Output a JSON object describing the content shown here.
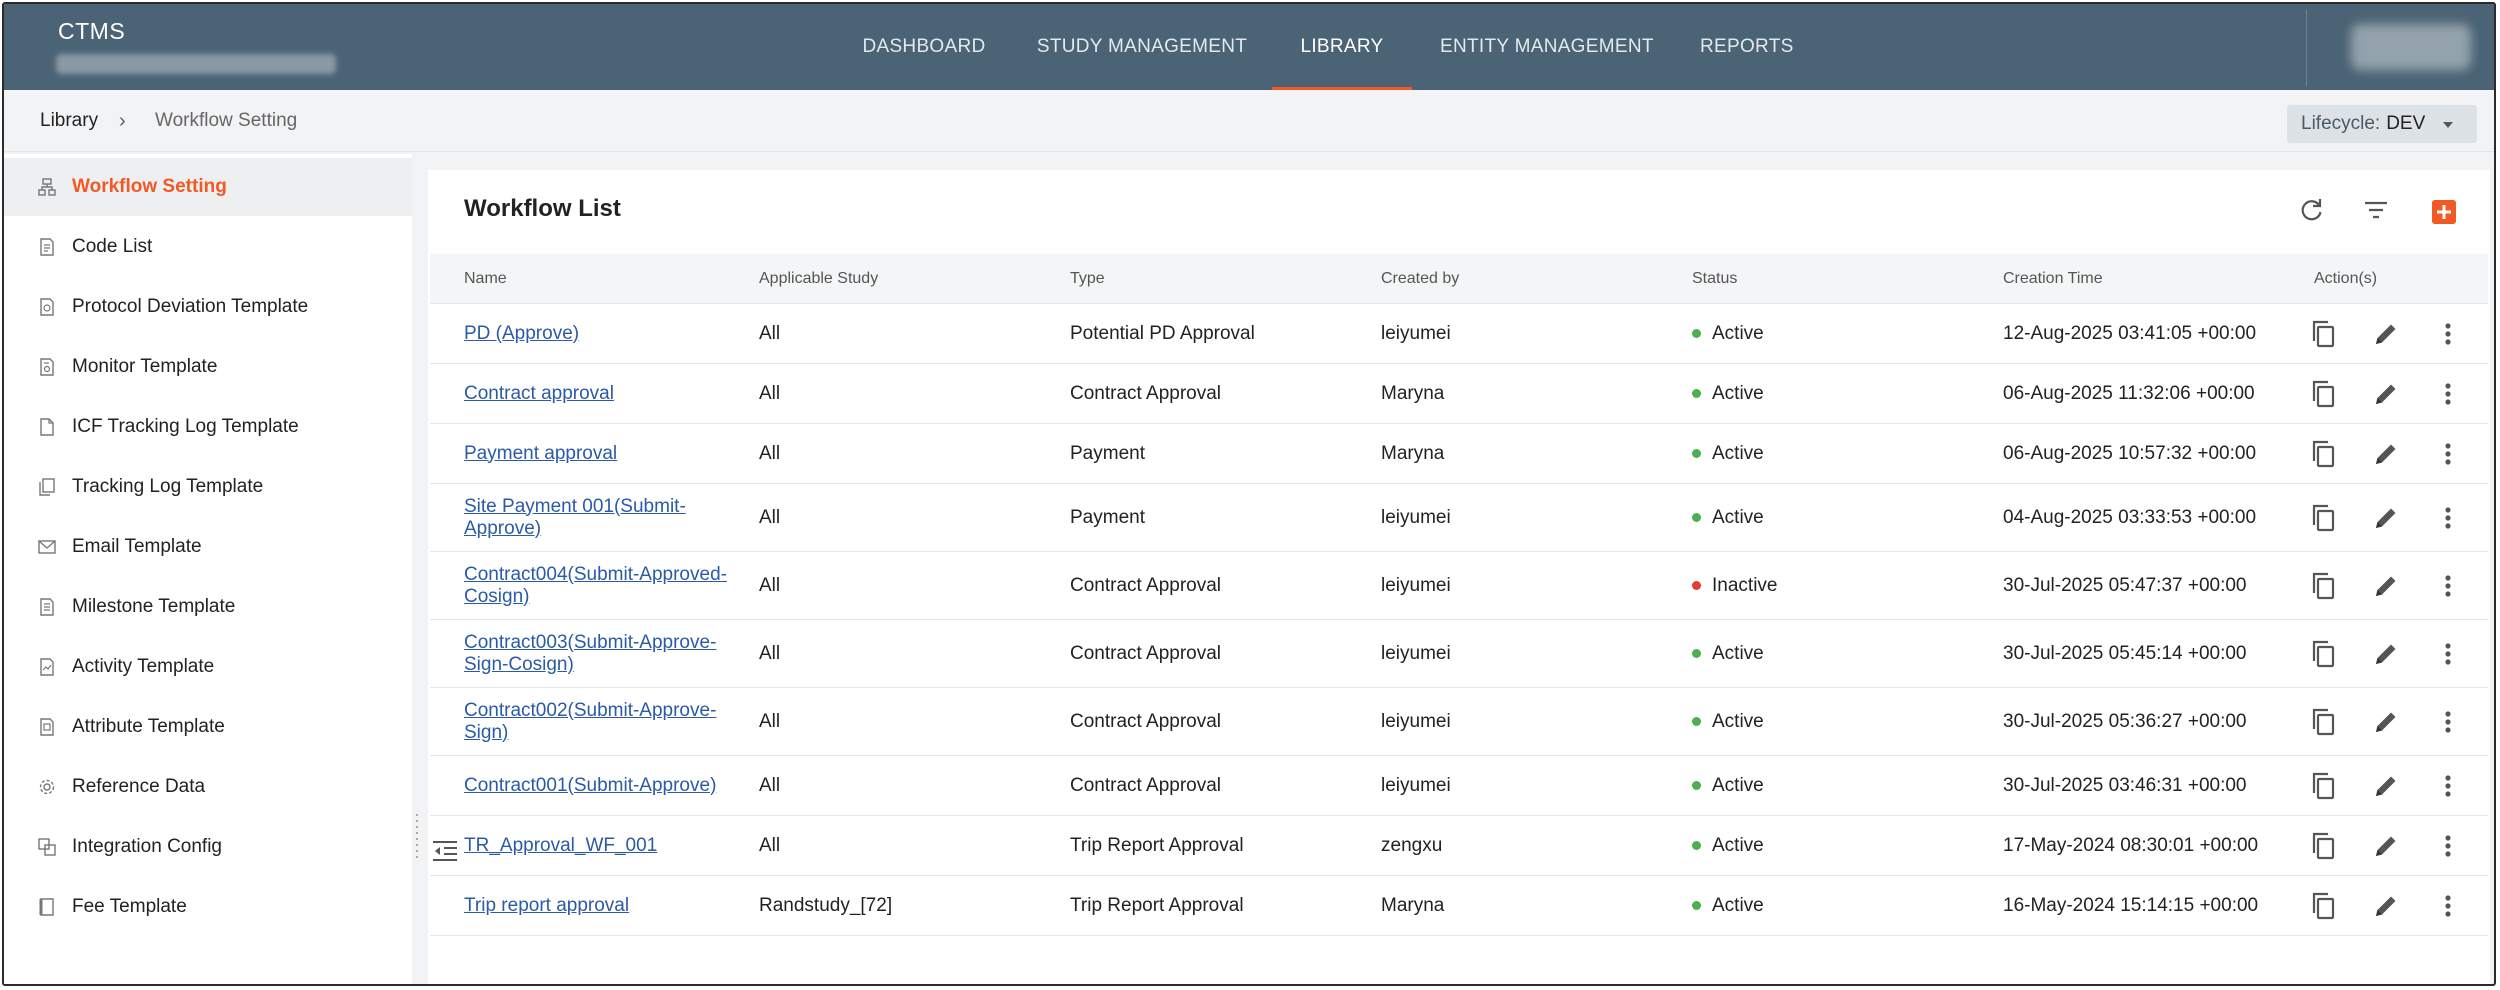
{
  "app": {
    "title": "CTMS"
  },
  "nav": {
    "items": [
      {
        "label": "DASHBOARD",
        "active": false
      },
      {
        "label": "STUDY MANAGEMENT",
        "active": false
      },
      {
        "label": "LIBRARY",
        "active": true
      },
      {
        "label": "ENTITY MANAGEMENT",
        "active": false
      },
      {
        "label": "REPORTS",
        "active": false
      }
    ]
  },
  "breadcrumb": {
    "root": "Library",
    "separator": "›",
    "current": "Workflow Setting"
  },
  "lifecycle": {
    "label": "Lifecycle:",
    "value": "DEV"
  },
  "sidebar": {
    "items": [
      {
        "label": "Workflow Setting",
        "icon": "workflow-icon",
        "active": true
      },
      {
        "label": "Code List",
        "icon": "code-list-icon",
        "active": false
      },
      {
        "label": "Protocol Deviation Template",
        "icon": "protocol-deviation-icon",
        "active": false
      },
      {
        "label": "Monitor Template",
        "icon": "monitor-icon",
        "active": false
      },
      {
        "label": "ICF Tracking Log Template",
        "icon": "document-icon",
        "active": false
      },
      {
        "label": "Tracking Log Template",
        "icon": "tracking-log-icon",
        "active": false
      },
      {
        "label": "Email Template",
        "icon": "email-icon",
        "active": false
      },
      {
        "label": "Milestone Template",
        "icon": "milestone-icon",
        "active": false
      },
      {
        "label": "Activity Template",
        "icon": "activity-icon",
        "active": false
      },
      {
        "label": "Attribute Template",
        "icon": "attribute-icon",
        "active": false
      },
      {
        "label": "Reference Data",
        "icon": "gear-icon",
        "active": false
      },
      {
        "label": "Integration Config",
        "icon": "integration-icon",
        "active": false
      },
      {
        "label": "Fee Template",
        "icon": "fee-icon",
        "active": false
      }
    ]
  },
  "main": {
    "title": "Workflow List",
    "toolbar": {
      "refresh_icon": "refresh-icon",
      "filter_icon": "filter-icon",
      "add_icon": "add-icon"
    },
    "columns": [
      "Name",
      "Applicable Study",
      "Type",
      "Created by",
      "Status",
      "Creation Time",
      "Action(s)"
    ],
    "rows": [
      {
        "name": "PD (Approve)",
        "study": "All",
        "type": "Potential PD Approval",
        "created_by": "leiyumei",
        "status": "Active",
        "time": "12-Aug-2025 03:41:05 +00:00"
      },
      {
        "name": "Contract approval",
        "study": "All",
        "type": "Contract Approval",
        "created_by": "Maryna",
        "status": "Active",
        "time": "06-Aug-2025 11:32:06 +00:00"
      },
      {
        "name": "Payment approval",
        "study": "All",
        "type": "Payment",
        "created_by": "Maryna",
        "status": "Active",
        "time": "06-Aug-2025 10:57:32 +00:00"
      },
      {
        "name": "Site Payment 001(Submit-Approve)",
        "study": "All",
        "type": "Payment",
        "created_by": "leiyumei",
        "status": "Active",
        "time": "04-Aug-2025 03:33:53 +00:00"
      },
      {
        "name": "Contract004(Submit-Approved-Cosign)",
        "study": "All",
        "type": "Contract Approval",
        "created_by": "leiyumei",
        "status": "Inactive",
        "time": "30-Jul-2025 05:47:37 +00:00"
      },
      {
        "name": "Contract003(Submit-Approve-Sign-Cosign)",
        "study": "All",
        "type": "Contract Approval",
        "created_by": "leiyumei",
        "status": "Active",
        "time": "30-Jul-2025 05:45:14 +00:00"
      },
      {
        "name": "Contract002(Submit-Approve-Sign)",
        "study": "All",
        "type": "Contract Approval",
        "created_by": "leiyumei",
        "status": "Active",
        "time": "30-Jul-2025 05:36:27 +00:00"
      },
      {
        "name": "Contract001(Submit-Approve)",
        "study": "All",
        "type": "Contract Approval",
        "created_by": "leiyumei",
        "status": "Active",
        "time": "30-Jul-2025 03:46:31 +00:00"
      },
      {
        "name": "TR_Approval_WF_001",
        "study": "All",
        "type": "Trip Report Approval",
        "created_by": "zengxu",
        "status": "Active",
        "time": "17-May-2024 08:30:01 +00:00"
      },
      {
        "name": "Trip report approval",
        "study": "Randstudy_[72]",
        "type": "Trip Report Approval",
        "created_by": "Maryna",
        "status": "Active",
        "time": "16-May-2024 15:14:15 +00:00"
      }
    ],
    "row_actions": [
      "copy-icon",
      "edit-icon",
      "more-vertical-icon"
    ]
  },
  "colors": {
    "header_bg": "#4b6475",
    "accent": "#f15a24",
    "link": "#2b5aa8",
    "status_active": "#4caf50",
    "status_inactive": "#e53935"
  }
}
